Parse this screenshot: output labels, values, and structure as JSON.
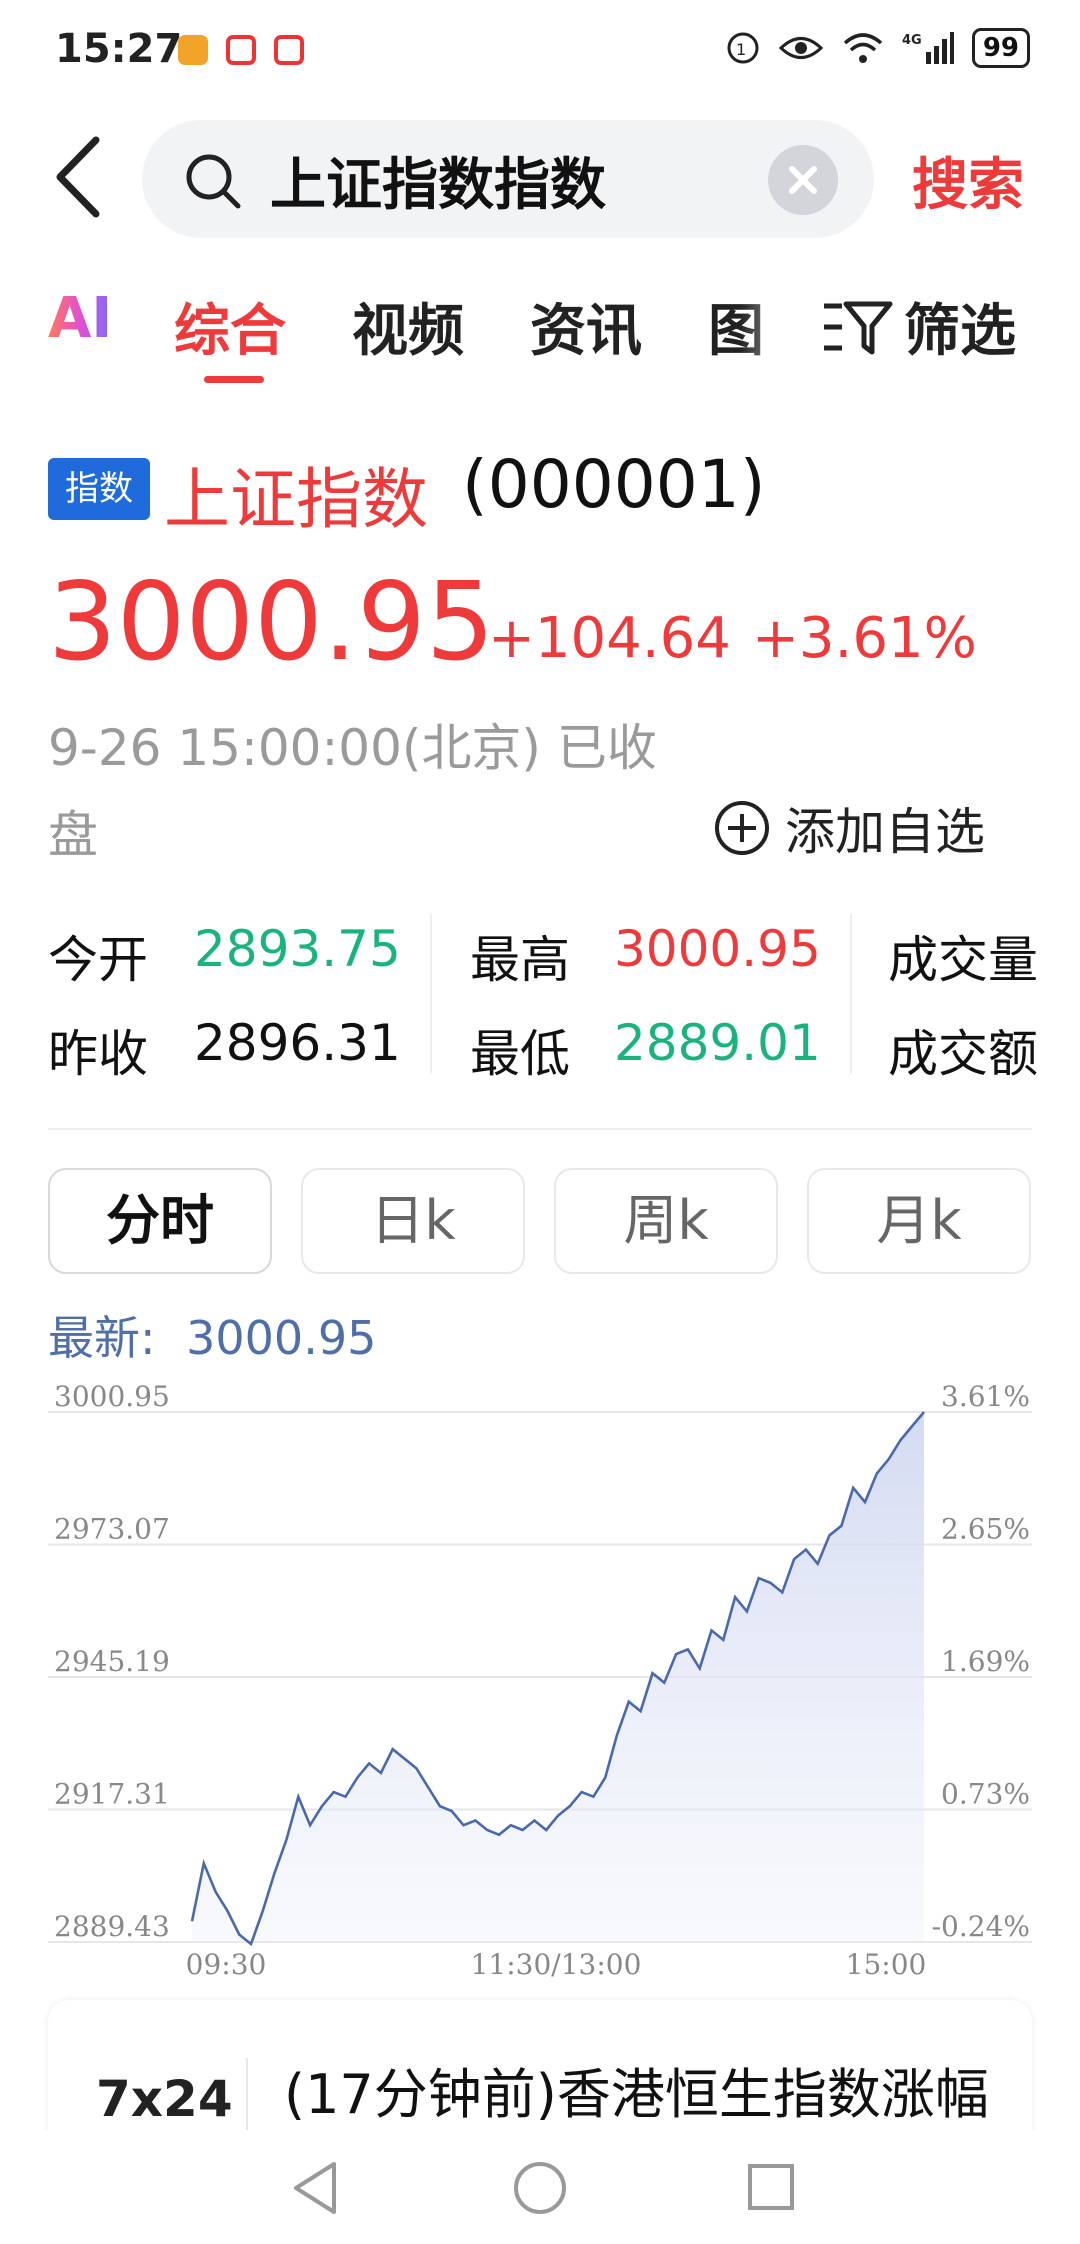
{
  "status_bar": {
    "time": "15:27",
    "battery": "99",
    "network": "4G"
  },
  "search": {
    "query": "上证指数指数",
    "action_label": "搜索"
  },
  "tabs": [
    {
      "label": "AI"
    },
    {
      "label": "综合",
      "active": true
    },
    {
      "label": "视频"
    },
    {
      "label": "资讯"
    },
    {
      "label": "图"
    }
  ],
  "filter_label": "筛选",
  "quote": {
    "badge": "指数",
    "name": "上证指数",
    "code": "(000001)",
    "price": "3000.95",
    "change": "+104.64",
    "change_pct": "+3.61%",
    "time_line1": "9-26 15:00:00(北京) 已收",
    "time_line2": "盘",
    "add_watch_label": "添加自选"
  },
  "stats": {
    "open_label": "今开",
    "open_value": "2893.75",
    "prev_close_label": "昨收",
    "prev_close_value": "2896.31",
    "high_label": "最高",
    "high_value": "3000.95",
    "low_label": "最低",
    "low_value": "2889.01",
    "volume_label": "成交量",
    "amount_label": "成交额"
  },
  "period_tabs": [
    {
      "label": "分时",
      "active": true
    },
    {
      "label": "日k"
    },
    {
      "label": "周k"
    },
    {
      "label": "月k"
    }
  ],
  "latest": {
    "label": "最新:",
    "value": "3000.95"
  },
  "chart_data": {
    "type": "area",
    "y_left_ticks": [
      "3000.95",
      "2973.07",
      "2945.19",
      "2917.31",
      "2889.43"
    ],
    "y_right_ticks": [
      "3.61%",
      "2.65%",
      "1.69%",
      "0.73%",
      "-0.24%"
    ],
    "x_ticks": [
      "09:30",
      "11:30/13:00",
      "15:00"
    ],
    "ylim": [
      2889.43,
      3000.95
    ],
    "series": [
      {
        "values": [
          2893.8,
          2906,
          2900,
          2896,
          2891,
          2889,
          2896,
          2904,
          2911,
          2920,
          2914,
          2918,
          2921,
          2920,
          2924,
          2927,
          2925,
          2930,
          2928,
          2926,
          2922,
          2918,
          2917,
          2914,
          2915,
          2913,
          2912,
          2914,
          2913,
          2915,
          2913,
          2916,
          2918,
          2921,
          2920,
          2924,
          2933,
          2940,
          2938,
          2946,
          2944,
          2950,
          2951,
          2947,
          2955,
          2953,
          2962,
          2959,
          2966,
          2965,
          2963,
          2970,
          2972,
          2969,
          2975,
          2977,
          2985,
          2982,
          2988,
          2991,
          2995,
          2998,
          3000.95
        ]
      }
    ]
  },
  "news": {
    "source": "7x24",
    "text": "(17分钟前)香港恒生指数涨幅"
  }
}
